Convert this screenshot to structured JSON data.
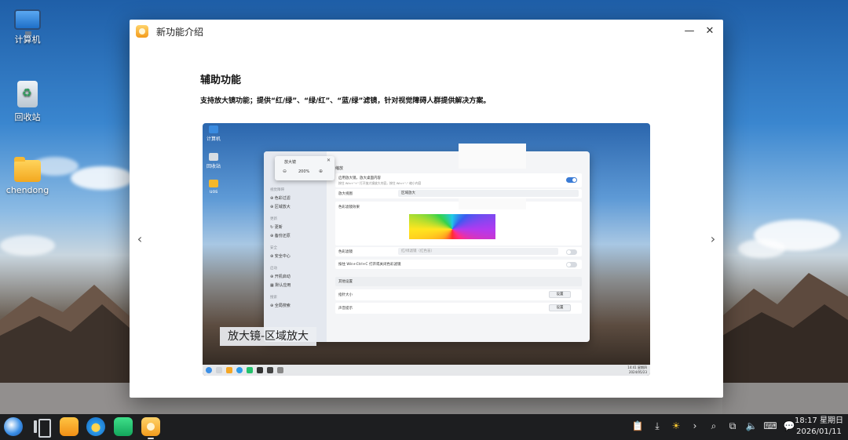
{
  "desktop": {
    "icons": [
      {
        "label": "计算机",
        "icon": "computer-icon"
      },
      {
        "label": "回收站",
        "icon": "trash-icon"
      },
      {
        "label": "chendong",
        "icon": "folder-icon"
      }
    ]
  },
  "window": {
    "title": "新功能介绍",
    "minimize_glyph": "—",
    "close_glyph": "✕",
    "prev_glyph": "‹",
    "next_glyph": "›"
  },
  "page": {
    "heading": "辅助功能",
    "description": "支持放大镜功能；提供“红/绿”、“绿/红”、“蓝/绿”滤镜，针对视觉障碍人群提供解决方案。",
    "screenshot": {
      "caption": "放大镜-区域放大",
      "desktop_icons": [
        "计算机",
        "回收站",
        "uos"
      ],
      "magnifier": {
        "title": "放大镜",
        "zoom": "200%",
        "minus": "⊖",
        "plus": "⊕",
        "close": "✕"
      },
      "sidebar": {
        "cat1": "视觉障碍",
        "item1": "⊕ 色彩过滤",
        "item2": "⊕ 区域放大",
        "cat2": "更新",
        "item3": "↻ 更新",
        "item4": "⊕ 备份还原",
        "cat3": "安全",
        "item5": "⊕ 安全中心",
        "cat4": "启动",
        "item6": "⊕ 开机启动",
        "item7": "▦ 默认应用",
        "cat5": "搜索",
        "item8": "⊕ 全局搜索"
      },
      "panel": {
        "section": "缩放",
        "row1_label": "启用放大镜，放大桌面内容",
        "row1_sub": "按住 Win+\"+\" 打开放大镜放大内容，按住 Win+\"-\" 缩小内容",
        "row2_label": "放大视图",
        "row2_value": "区域放大",
        "row3_label": "色彩滤镜效果",
        "row4_label": "色彩滤镜",
        "row4_value": "红/绿滤镜（红色盲）",
        "row5_label": "按住 Win+Ctrl+C 打开或关闭色彩滤镜",
        "row6_label": "其他设置",
        "row7_label": "指针大小",
        "row7_btn": "设置",
        "row8_label": "声音提示",
        "row8_btn": "设置"
      },
      "clock_time": "14:41 星期四",
      "clock_date": "2024/05/23"
    }
  },
  "taskbar": {
    "apps": [
      "launcher-icon",
      "multitask-icon",
      "notes-icon",
      "browser-icon",
      "app-store-icon",
      "new-features-icon"
    ],
    "tray": [
      {
        "icon": "clipboard-icon",
        "glyph": "📋"
      },
      {
        "icon": "download-icon",
        "glyph": "⤓"
      },
      {
        "icon": "brightness-icon",
        "glyph": "☀"
      },
      {
        "icon": "expand-icon",
        "glyph": "›"
      },
      {
        "icon": "search-icon",
        "glyph": "⌕"
      },
      {
        "icon": "screenshot-icon",
        "glyph": "⧉"
      },
      {
        "icon": "volume-icon",
        "glyph": "🔈"
      },
      {
        "icon": "keyboard-icon",
        "glyph": "⌨"
      },
      {
        "icon": "notification-icon",
        "glyph": "💬"
      }
    ],
    "clock_time": "18:17 星期日",
    "clock_date": "2026/01/11"
  }
}
